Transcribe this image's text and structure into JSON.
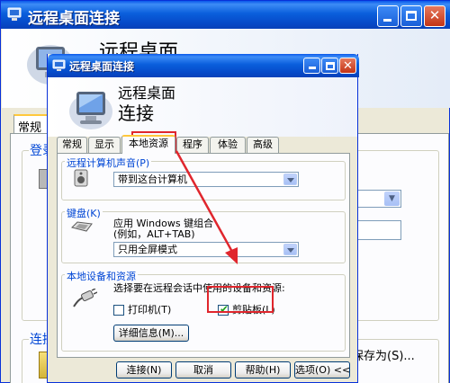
{
  "back_window": {
    "title": "远程桌面连接",
    "banner_title": "远程桌面",
    "tab_general": "常规",
    "group_login": "登录",
    "group_connect": "连接",
    "save_as_label": "保存为(S)..."
  },
  "dialog": {
    "title": "远程桌面连接",
    "banner_line1": "远程桌面",
    "banner_line2": "连接",
    "tabs": [
      {
        "label": "常规"
      },
      {
        "label": "显示"
      },
      {
        "label": "本地资源"
      },
      {
        "label": "程序"
      },
      {
        "label": "体验"
      },
      {
        "label": "高级"
      }
    ],
    "active_tab": "本地资源",
    "sound": {
      "group_label": "远程计算机声音(P)",
      "selected": "带到这台计算机"
    },
    "keyboard": {
      "group_label": "键盘(K)",
      "desc_line1": "应用 Windows 键组合",
      "desc_line2": "(例如，ALT+TAB)",
      "selected": "只用全屏模式"
    },
    "devices": {
      "group_label": "本地设备和资源",
      "prompt": "选择要在远程会话中使用的设备和资源:",
      "printer_label": "打印机(T)",
      "printer_checked": false,
      "clipboard_label": "剪贴板(L)",
      "clipboard_checked": true,
      "details_label": "详细信息(M)..."
    },
    "buttons": {
      "connect": "连接(N)",
      "cancel": "取消",
      "help": "帮助(H)",
      "options": "选项(O) <<"
    }
  },
  "colors": {
    "titlebar": "#0a5fdc",
    "group_label": "#0046d5",
    "highlight": "#e0262d",
    "tab_accent": "#ffc83c"
  }
}
